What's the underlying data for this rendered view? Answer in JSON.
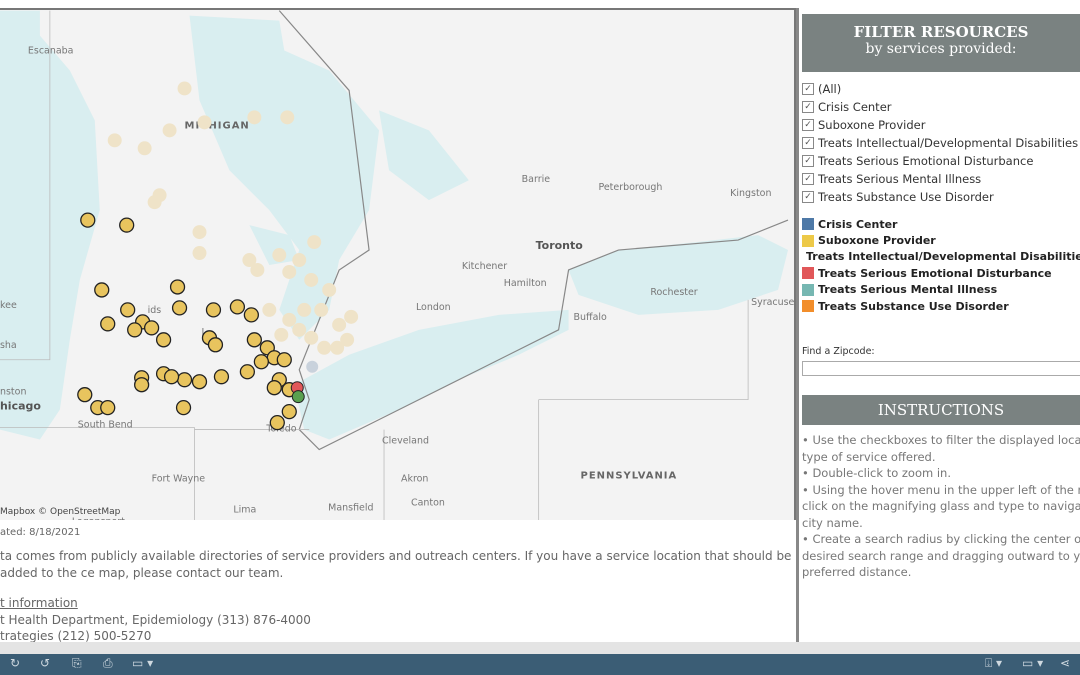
{
  "map": {
    "state_labels": [
      "MICHIGAN",
      "PENNSYLVANIA"
    ],
    "city_labels": [
      "Escanaba",
      "Barrie",
      "Peterborough",
      "Kingston",
      "Toronto",
      "Kitchener",
      "Hamilton",
      "Rochester",
      "London",
      "Syracuse",
      "Buffalo",
      "kee",
      "sha",
      "nston",
      "hicago",
      "South Bend",
      "Toledo",
      "Cleveland",
      "Akron",
      "Fort Wayne",
      "Canton",
      "Mansfield",
      "Lima",
      "Logansport",
      "ids",
      "L"
    ],
    "attribution": "Mapbox © OpenStreetMap",
    "colors": {
      "land": "#f3f3f3",
      "water": "#d9eef0",
      "suboxone": "#e8c45e",
      "faded": "#efe3c8",
      "crisis": "#4e79a7",
      "green": "#59a14f",
      "red": "#e15759"
    }
  },
  "footer": {
    "updated": "ated: 8/18/2021",
    "description": "ta comes from publicly available directories of service providers and outreach centers. If you have a service location that should be added to the ce map, please contact our team.",
    "contact_heading": "t information",
    "contact_lines": [
      "t Health Department, Epidemiology (313) 876-4000",
      "trategies (212) 500-5270"
    ]
  },
  "filter": {
    "title": "FILTER RESOURCES",
    "subtitle": "by services provided:",
    "options": [
      {
        "label": "(All)",
        "checked": true
      },
      {
        "label": "Crisis Center",
        "checked": true
      },
      {
        "label": "Suboxone Provider",
        "checked": true
      },
      {
        "label": "Treats Intellectual/Developmental Disabilities",
        "checked": true
      },
      {
        "label": "Treats Serious Emotional Disturbance",
        "checked": true
      },
      {
        "label": "Treats Serious Mental Illness",
        "checked": true
      },
      {
        "label": "Treats Substance Use Disorder",
        "checked": true
      }
    ]
  },
  "legend": [
    {
      "label": "Crisis Center",
      "color": "#4e79a7"
    },
    {
      "label": "Suboxone Provider",
      "color": "#edc948"
    },
    {
      "label": "Treats Intellectual/Developmental Disabilities",
      "color": "#59a14f"
    },
    {
      "label": "Treats Serious Emotional Disturbance",
      "color": "#e15759"
    },
    {
      "label": "Treats Serious Mental Illness",
      "color": "#76b7b2"
    },
    {
      "label": "Treats Substance Use Disorder",
      "color": "#f28e2b"
    }
  ],
  "zipcode": {
    "label": "Find a Zipcode:",
    "value": ""
  },
  "instructions": {
    "title": "INSTRUCTIONS",
    "lines": [
      "• Use the checkboxes to filter the displayed locatio",
      "type of service offered.",
      "• Double-click to zoom in.",
      "• Using the hover menu in the upper left of the map",
      "click on the magnifying glass and type to navigate",
      "city name.",
      "• Create a search radius by clicking the center of yo",
      "desired search range and dragging outward to you",
      "preferred distance."
    ]
  },
  "toolbar": {
    "icons": [
      "redo-icon",
      "undo-icon",
      "revert-icon",
      "pause-icon",
      "refresh-icon",
      "download-icon",
      "device-layout-icon",
      "share-icon"
    ]
  }
}
